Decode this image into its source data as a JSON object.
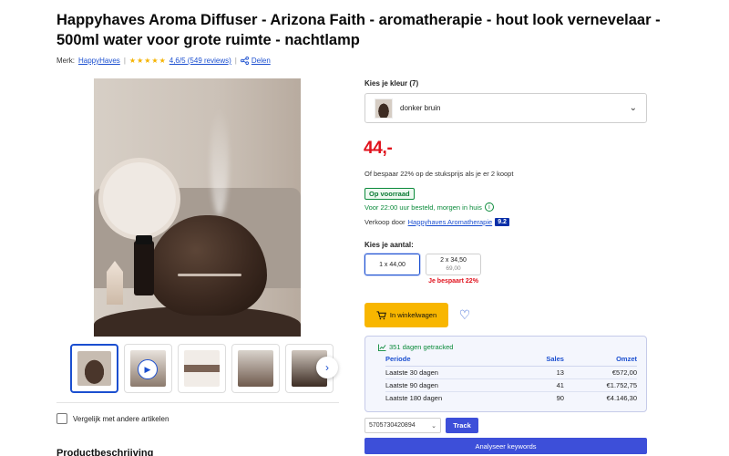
{
  "product": {
    "title": "Happyhaves Aroma Diffuser - Arizona Faith - aromatherapie - hout look vernevelaar - 500ml water voor grote ruimte - nachtlamp",
    "brand_label": "Merk:",
    "brand": "HappyHaves",
    "rating_value": 4.6,
    "rating_text": "4,6/5 (549 reviews)",
    "share": "Delen"
  },
  "gallery": {
    "thumbnails": [
      "diffuser-main",
      "video",
      "info-card",
      "lifestyle",
      "detail"
    ],
    "icons": {
      "play": "play-icon",
      "next": "chevron-right-icon"
    }
  },
  "compare_label": "Vergelijk met andere artikelen",
  "description_heading": "Productbeschrijving",
  "options": {
    "color_label": "Kies je kleur (7)",
    "selected_color": "donker bruin"
  },
  "pricing": {
    "price": "44,-",
    "multi_buy": "Of bespaar 22% op de stuksprijs als je er 2 koopt",
    "stock_badge": "Op voorraad",
    "delivery": "Voor 22:00 uur besteld, morgen in huis",
    "seller_prefix": "Verkoop door",
    "seller_name": "Happyhaves Aromatherapie",
    "seller_score": "9.2",
    "color_price": "#e0101b",
    "color_stock": "#0a8a3a",
    "color_accent": "#1b4fd0"
  },
  "quantity": {
    "label": "Kies je aantal:",
    "option_1": "1 x 44,00",
    "option_2": "2 x 34,50",
    "option_2_old": "69,00",
    "option_2_saving": "Je bespaart 22%"
  },
  "cart": {
    "add_label": "In winkelwagen",
    "button_color": "#f8b600"
  },
  "tracker": {
    "tracked_text": "351 dagen getracked",
    "headers": [
      "Periode",
      "Sales",
      "Omzet"
    ],
    "rows": [
      [
        "Laatste 30 dagen",
        "13",
        "€572,00"
      ],
      [
        "Laatste 90 dagen",
        "41",
        "€1.752,75"
      ],
      [
        "Laatste 180 dagen",
        "90",
        "€4.146,30"
      ]
    ],
    "ean_value": "5705730420894",
    "track_button": "Track",
    "analyse_button": "Analyseer keywords",
    "button_color": "#3d4fd9"
  }
}
